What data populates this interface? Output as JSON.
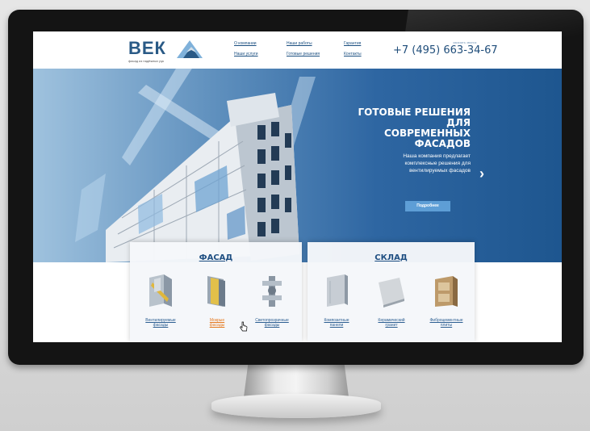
{
  "header": {
    "logo": "ВЕК",
    "logo_sub": "фасад из надёжных рук",
    "nav": {
      "about": "О компании",
      "works": "Наши работы",
      "guarantee": "Гарантия",
      "services": "Наши услуги",
      "solutions": "Готовые решения",
      "contacts": "Контакты"
    },
    "phone_caption": "заказать звонок",
    "phone": "+7 (495) 663-34-67"
  },
  "hero": {
    "title_line1": "ГОТОВЫЕ РЕШЕНИЯ ДЛЯ",
    "title_line2": "СОВРЕМЕННЫХ",
    "title_line3": "ФАСАДОВ",
    "desc_line1": "Наша компания предлагает",
    "desc_line2": "комплексные решения для",
    "desc_line3": "вентилируемых фасадов",
    "button": "Подробнее",
    "arrow": "›"
  },
  "panels": {
    "left": {
      "title": "ФАСАД",
      "items": [
        {
          "line1": "Вентилируемые",
          "line2": "фасады"
        },
        {
          "line1": "Мокрые",
          "line2": "фасады"
        },
        {
          "line1": "Светопрозрачные",
          "line2": "фасады"
        }
      ]
    },
    "right": {
      "title": "СКЛАД",
      "items": [
        {
          "line1": "Композитные",
          "line2": "панели"
        },
        {
          "line1": "Керамический",
          "line2": "гранит"
        },
        {
          "line1": "Фиброцементные",
          "line2": "плиты"
        }
      ]
    }
  },
  "colors": {
    "brand": "#2a5a86",
    "hero_dark": "#1e568f",
    "accent": "#5e9ed6",
    "active": "#e57a20"
  }
}
